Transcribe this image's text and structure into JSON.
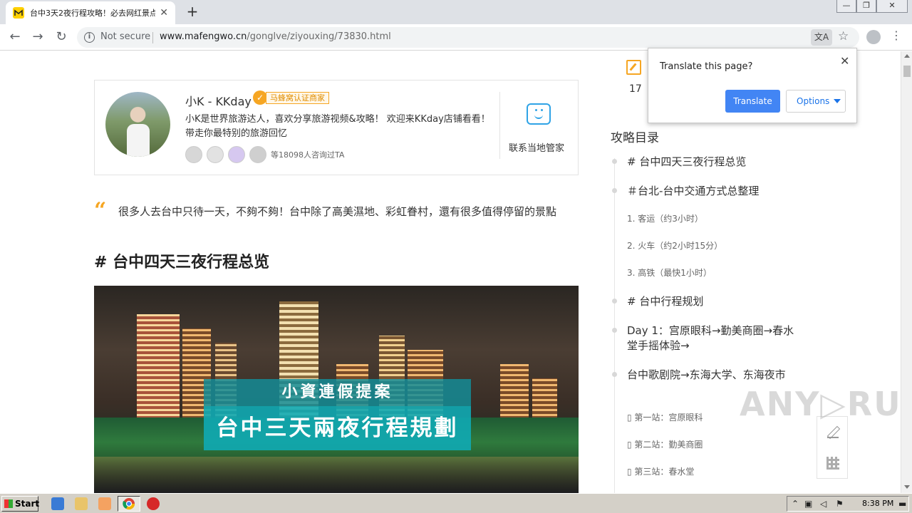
{
  "browser": {
    "tab_title": "台中3天2夜行程攻略！必去网红景点",
    "tab_close": "✕",
    "new_tab": "+",
    "security_label": "Not secure",
    "url_domain": "www.mafengwo.cn",
    "url_path": "/gonglve/ziyouxing/73830.html",
    "window_buttons": [
      "—",
      "❐",
      "✕"
    ]
  },
  "translate_popup": {
    "title": "Translate this page?",
    "translate_button": "Translate",
    "options_button": "Options",
    "close": "✕"
  },
  "author": {
    "name": "小K - KKday",
    "badge": "马蜂窝认证商家",
    "bio": "小K是世界旅游达人，喜欢分享旅游视频&攻略！ 欢迎来KKday店铺看看！带走你最特别的旅游回忆",
    "consult_text": "等18098人咨询过TA",
    "contact_label": "联系当地管家"
  },
  "article": {
    "quote": "很多人去台中只待一天，不夠不夠！台中除了高美濕地、彩虹眷村，還有很多值得停留的景點",
    "section_title": "# 台中四天三夜行程总览",
    "image_banner_top": "小資連假提案",
    "image_banner_bottom": "台中三天兩夜行程規劃"
  },
  "sidebar": {
    "edit_count": "17",
    "toc_title": "攻略目录",
    "toc": [
      {
        "label": "# 台中四天三夜行程总览",
        "level": 1
      },
      {
        "label": "＃台北-台中交通方式总整理",
        "level": 1
      },
      {
        "label": "1. 客运（约3小时）",
        "level": 2
      },
      {
        "label": "2. 火车（约2小时15分）",
        "level": 2
      },
      {
        "label": "3. 高铁（最快1小时）",
        "level": 2
      },
      {
        "label": "# 台中行程规划",
        "level": 1
      },
      {
        "label": "Day 1：宫原眼科→勤美商圈→春水堂手摇体验→",
        "level": 1
      },
      {
        "label": "台中歌剧院→东海大学、东海夜市",
        "level": 1
      },
      {
        "label": "▯ 第一站：宫原眼科",
        "level": 2
      },
      {
        "label": "▯ 第二站：勤美商圈",
        "level": 2
      },
      {
        "label": "▯ 第三站：春水堂",
        "level": 2
      }
    ]
  },
  "watermark": "ANY▷RUN",
  "taskbar": {
    "start_label": "Start",
    "clock": "8:38 PM"
  },
  "colors": {
    "accent_orange": "#f6a623",
    "chrome_blue": "#4285f4",
    "banner_teal": "#10aab4"
  }
}
